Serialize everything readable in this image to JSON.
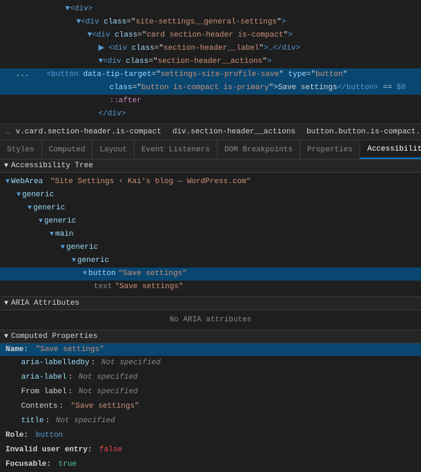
{
  "code": {
    "lines": [
      {
        "id": "l1",
        "indent": 80,
        "content": "<div>",
        "type": "normal"
      },
      {
        "id": "l2",
        "indent": 96,
        "content": "<div class=\"site-settings__general-settings\">",
        "type": "normal"
      },
      {
        "id": "l3",
        "indent": 112,
        "content": "<div class=\"card section-header is-compact\">",
        "type": "normal"
      },
      {
        "id": "l4",
        "indent": 128,
        "content": "<div class=\"section-header__label\">…</div>",
        "type": "normal"
      },
      {
        "id": "l5",
        "indent": 128,
        "content": "<div class=\"section-header__actions\">",
        "type": "normal"
      },
      {
        "id": "l6",
        "indent": 144,
        "content": "<button data-tip-target=\"settings-site-profile-save\" type=\"button\"",
        "type": "selected",
        "continuation": false
      },
      {
        "id": "l7",
        "indent": 144,
        "content": "class=\"button is-compact is-primary\">Save settings</button> == $0",
        "type": "selected"
      },
      {
        "id": "l8",
        "indent": 144,
        "content": "::after",
        "type": "normal"
      },
      {
        "id": "l9",
        "indent": 128,
        "content": "</div>",
        "type": "normal"
      }
    ]
  },
  "breadcrumb": {
    "ellipsis": "…",
    "items": [
      {
        "id": "b1",
        "label": "v.card.section-header.is-compact",
        "active": false
      },
      {
        "id": "b2",
        "label": "div.section-header__actions",
        "active": false
      },
      {
        "id": "b3",
        "label": "button.button.is-compact.is-primary",
        "active": false
      }
    ],
    "trailing_ellipsis": "…"
  },
  "tabs": {
    "items": [
      {
        "id": "t1",
        "label": "Styles",
        "active": false
      },
      {
        "id": "t2",
        "label": "Computed",
        "active": false
      },
      {
        "id": "t3",
        "label": "Layout",
        "active": false
      },
      {
        "id": "t4",
        "label": "Event Listeners",
        "active": false
      },
      {
        "id": "t5",
        "label": "DOM Breakpoints",
        "active": false
      },
      {
        "id": "t6",
        "label": "Properties",
        "active": false
      },
      {
        "id": "t7",
        "label": "Accessibility",
        "active": true
      }
    ]
  },
  "accessibility_tree": {
    "section_label": "Accessibility Tree",
    "nodes": [
      {
        "id": "n1",
        "indent": 0,
        "toggle": "▼",
        "role": "WebArea",
        "name": "\"Site Settings ‹ Kai's blog — WordPress.com\""
      },
      {
        "id": "n2",
        "indent": 16,
        "toggle": "▼",
        "role": "generic",
        "name": ""
      },
      {
        "id": "n3",
        "indent": 32,
        "toggle": "▼",
        "role": "generic",
        "name": ""
      },
      {
        "id": "n4",
        "indent": 48,
        "toggle": "▼",
        "role": "generic",
        "name": ""
      },
      {
        "id": "n5",
        "indent": 64,
        "toggle": "▼",
        "role": "main",
        "name": ""
      },
      {
        "id": "n6",
        "indent": 80,
        "toggle": "▼",
        "role": "generic",
        "name": ""
      },
      {
        "id": "n7",
        "indent": 96,
        "toggle": "▼",
        "role": "generic",
        "name": ""
      },
      {
        "id": "n8",
        "indent": 112,
        "toggle": "▼",
        "role": "button",
        "name": "\"Save settings\"",
        "selected": true
      },
      {
        "id": "n9",
        "indent": 128,
        "toggle": "",
        "text_role": "text",
        "name": "\"Save settings\""
      }
    ]
  },
  "aria_attributes": {
    "section_label": "ARIA Attributes",
    "empty_message": "No ARIA attributes"
  },
  "computed_properties": {
    "section_label": "Computed Properties",
    "name_row": {
      "label": "Name:",
      "value": "\"Save settings\""
    },
    "props": [
      {
        "id": "p1",
        "name": "aria-labelledby",
        "colon": ":",
        "value": "Not specified",
        "style": "not-specified"
      },
      {
        "id": "p2",
        "name": "aria-label",
        "colon": ":",
        "value": "Not specified",
        "style": "not-specified"
      },
      {
        "id": "p3",
        "name": "From label",
        "colon": ":",
        "value": "Not specified",
        "style": "not-specified"
      },
      {
        "id": "p4",
        "name": "Contents",
        "colon": ":",
        "value": "\"Save settings\"",
        "style": "normal"
      },
      {
        "id": "p5",
        "name": "title",
        "colon": ":",
        "value": "Not specified",
        "style": "not-specified"
      }
    ],
    "role_row": {
      "label": "Role:",
      "value": "button"
    },
    "invalid_row": {
      "label": "Invalid user entry:",
      "value": "false"
    },
    "focusable_row": {
      "label": "Focusable:",
      "value": "true"
    }
  }
}
